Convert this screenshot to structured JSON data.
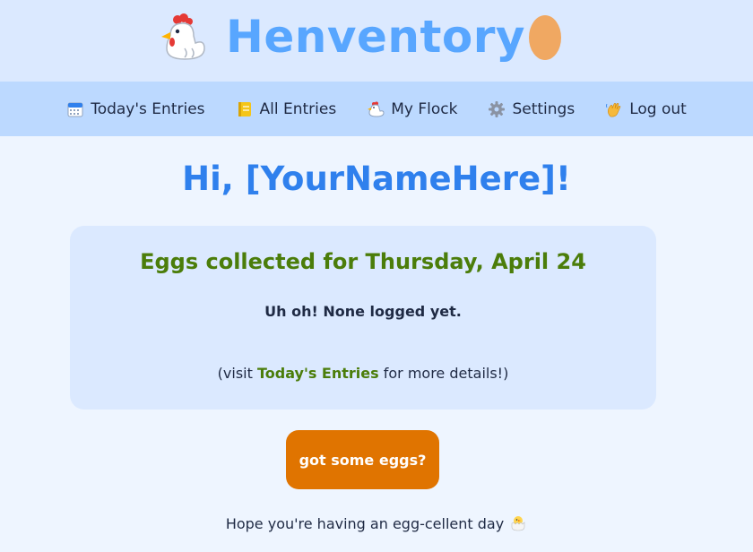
{
  "header": {
    "title": "Henventory",
    "left_icon": "chicken-icon",
    "right_icon": "egg-icon"
  },
  "nav": {
    "items": [
      {
        "label": "Today's Entries",
        "icon": "calendar-icon"
      },
      {
        "label": "All Entries",
        "icon": "notebook-icon"
      },
      {
        "label": "My Flock",
        "icon": "chicken-icon"
      },
      {
        "label": "Settings",
        "icon": "gear-icon"
      },
      {
        "label": "Log out",
        "icon": "wave-hand-icon"
      }
    ]
  },
  "main": {
    "greeting": "Hi, [YourNameHere]!",
    "card": {
      "title": "Eggs collected for Thursday, April 24",
      "empty_message": "Uh oh! None logged yet.",
      "note_prefix": "(visit ",
      "note_link": "Today's Entries",
      "note_suffix": " for more details!)"
    },
    "cta_label": "got some eggs?",
    "footer_text": "Hope you're having an egg-cellent day",
    "footer_icon": "hatching-chick-icon"
  },
  "colors": {
    "header_bg": "#dbe9ff",
    "nav_bg": "#bcd9ff",
    "page_bg": "#eef5ff",
    "title_blue": "#58a6ff",
    "greeting_blue": "#2f80ed",
    "green": "#4b7d0a",
    "cta_orange": "#e07400"
  }
}
